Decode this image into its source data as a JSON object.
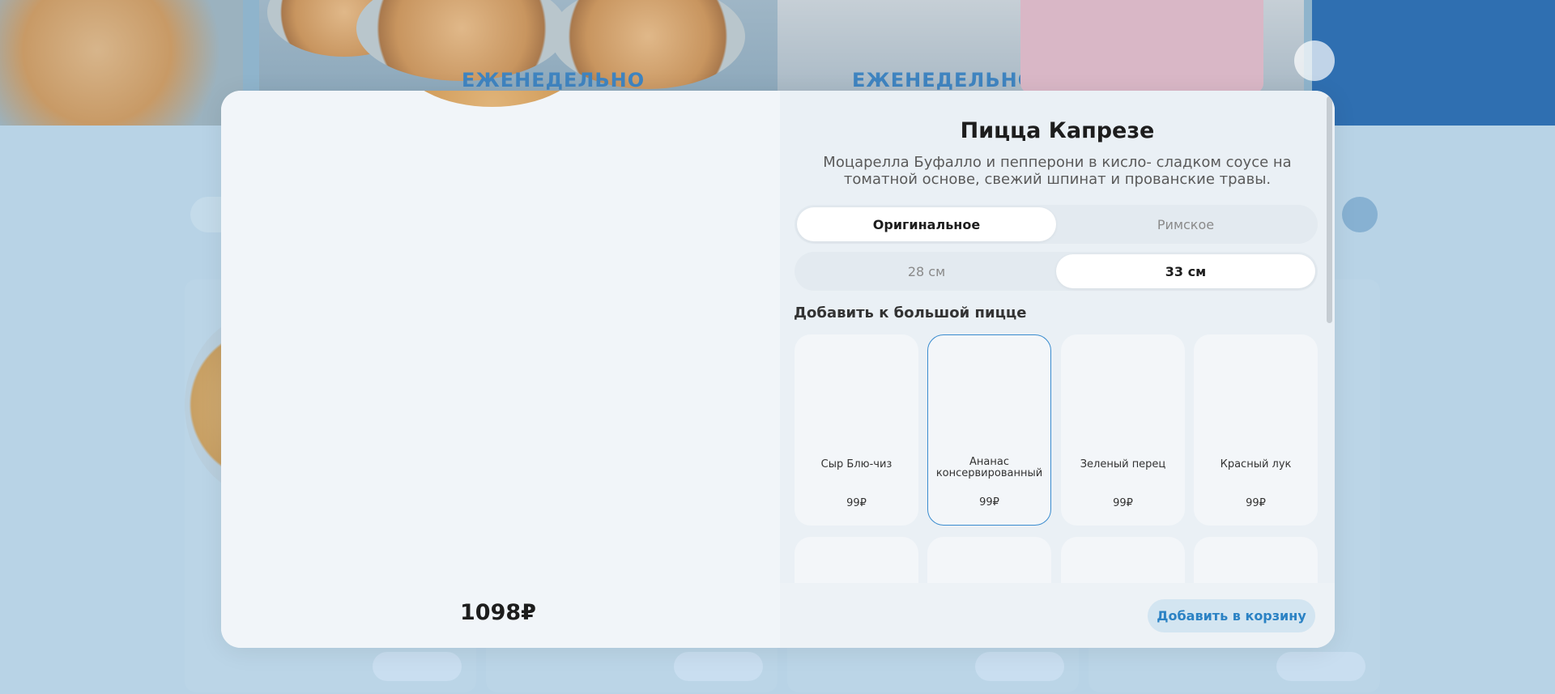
{
  "product": {
    "title": "Пицца Капрезе",
    "description": "Моцарелла Буфалло и пепперони в кисло- сладком соусе на томатной основе, свежий шпинат и прованские травы."
  },
  "dough_options": [
    {
      "label": "Оригинальное",
      "selected": true
    },
    {
      "label": "Римское",
      "selected": false
    }
  ],
  "size_options": [
    {
      "label": "28 см",
      "selected": false
    },
    {
      "label": "33 см",
      "selected": true
    }
  ],
  "toppings_section": {
    "title": "Добавить к большой пицце",
    "items": [
      {
        "name": "Сыр Блю-чиз",
        "price": "99₽",
        "selected": false
      },
      {
        "name": "Ананас консервированный",
        "price": "99₽",
        "selected": true
      },
      {
        "name": "Зеленый перец",
        "price": "99₽",
        "selected": false
      },
      {
        "name": "Красный лук",
        "price": "99₽",
        "selected": false
      }
    ]
  },
  "footer": {
    "total": "1098₽",
    "add_to_cart": "Добавить в корзину"
  },
  "colors": {
    "accent": "#2b82c4",
    "selected_border": "#3a8ccf",
    "overlay": "#a9c9de"
  }
}
